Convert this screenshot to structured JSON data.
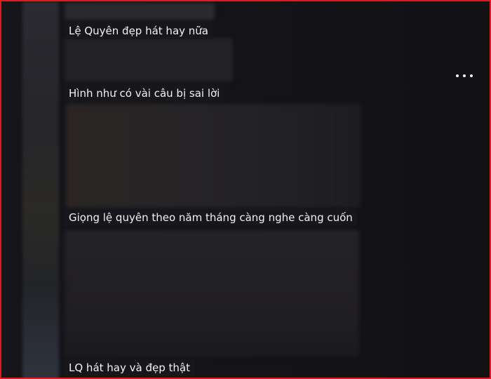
{
  "comments": [
    {
      "text": "Lệ Quyên đẹp hát hay nữa"
    },
    {
      "text": "Hình như có vài câu bị sai lời"
    },
    {
      "text": "Giọng lệ quyên theo năm tháng càng nghe càng cuốn"
    },
    {
      "text": "LQ hát hay và đẹp thật"
    }
  ],
  "menu": {
    "icon": "more-options-icon"
  },
  "colors": {
    "border": "#e01b1b",
    "background": "#111114",
    "text": "#f2f2f2"
  }
}
